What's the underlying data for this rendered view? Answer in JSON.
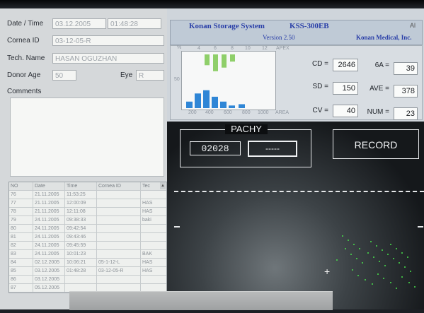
{
  "form": {
    "date_label": "Date / Time",
    "date_value": "03.12.2005",
    "time_value": "01:48:28",
    "cornea_label": "Cornea  ID",
    "cornea_value": "03-12-05-R",
    "tech_label": "Tech. Name",
    "tech_value": "HASAN OGUZHAN",
    "donor_label": "Donor  Age",
    "donor_value": "50",
    "eye_label": "Eye",
    "eye_value": "R",
    "comments_label": "Comments"
  },
  "table": {
    "headers": [
      "NO",
      "Date",
      "Time",
      "Cornea  ID",
      "Tec"
    ],
    "rows": [
      [
        "76",
        "21.11.2005",
        "11:53:25",
        "",
        ""
      ],
      [
        "77",
        "21.11.2005",
        "12:00:09",
        "",
        "HAS"
      ],
      [
        "78",
        "21.11.2005",
        "12:11:08",
        "",
        "HAS"
      ],
      [
        "79",
        "24.11.2005",
        "09:38:33",
        "",
        "baki"
      ],
      [
        "80",
        "24.11.2005",
        "09:42:54",
        "",
        ""
      ],
      [
        "81",
        "24.11.2005",
        "09:43:46",
        "",
        ""
      ],
      [
        "82",
        "24.11.2005",
        "09:45:59",
        "",
        ""
      ],
      [
        "83",
        "24.11.2005",
        "10:01:23",
        "",
        "BAK"
      ],
      [
        "84",
        "02.12.2005",
        "10:06:21",
        "05-1-12-L",
        "HAS"
      ],
      [
        "85",
        "03.12.2005",
        "01:48:28",
        "03-12-05-R",
        "HAS"
      ],
      [
        "86",
        "03.12.2005",
        "",
        "",
        ""
      ],
      [
        "87",
        "05.12.2005",
        "",
        "",
        ""
      ]
    ]
  },
  "header": {
    "title": "Konan Storage System",
    "model": "KSS-300EB",
    "version": "Version 2.50",
    "company": "Konan Medical, Inc.",
    "corner": "Al"
  },
  "histogram": {
    "pct_label": "%",
    "apex_label": "APEX",
    "area_label": "AREA",
    "top_ticks": [
      "4",
      "6",
      "8",
      "10",
      "12"
    ],
    "bottom_ticks": [
      "200",
      "400",
      "600",
      "800",
      "1000"
    ],
    "mid_tick": "50",
    "green_bars": [
      0.45,
      0.7,
      0.55,
      0.3
    ],
    "blue_bars": [
      0.2,
      0.45,
      0.55,
      0.35,
      0.2,
      0.08,
      0.12
    ],
    "colors": {
      "green": "#8fcf6a",
      "blue": "#2f86d6"
    }
  },
  "stats": {
    "cd_label": "CD =",
    "cd": "2646",
    "sd_label": "SD =",
    "sd": "150",
    "cv_label": "CV =",
    "cv": "40",
    "sixa_label": "6A =",
    "sixa": "39",
    "ave_label": "AVE =",
    "ave": "378",
    "num_label": "NUM =",
    "num": "23"
  },
  "pachy": {
    "title": "PACHY",
    "value": "02028",
    "placeholder": "-----"
  },
  "record_label": "RECORD"
}
